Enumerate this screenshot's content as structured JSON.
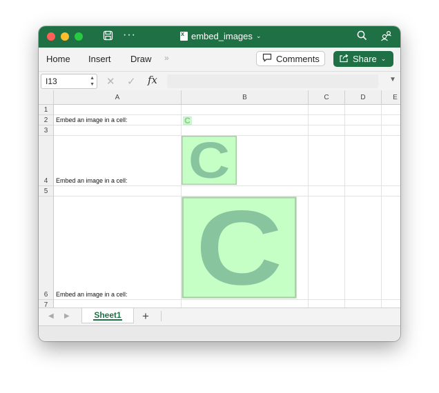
{
  "window": {
    "title": "embed_images"
  },
  "ribbon": {
    "tabs": [
      "Home",
      "Insert",
      "Draw"
    ],
    "more": "»",
    "comments_label": "Comments",
    "share_label": "Share"
  },
  "formula_bar": {
    "name_box": "I13",
    "fx_label": "fx",
    "value": ""
  },
  "columns": [
    "A",
    "B",
    "C",
    "D",
    "E"
  ],
  "rows": [
    {
      "num": "1",
      "text": ""
    },
    {
      "num": "2",
      "text": "Embed an image in a cell:"
    },
    {
      "num": "3",
      "text": ""
    },
    {
      "num": "4",
      "text": "Embed an image in a cell:"
    },
    {
      "num": "5",
      "text": ""
    },
    {
      "num": "6",
      "text": "Embed an image in a cell:"
    },
    {
      "num": "7",
      "text": ""
    }
  ],
  "embedded_images": [
    {
      "row": "2",
      "letter": "C"
    },
    {
      "row": "4",
      "letter": "C"
    },
    {
      "row": "6",
      "letter": "C"
    }
  ],
  "sheets": [
    {
      "name": "Sheet1",
      "active": true
    }
  ],
  "colors": {
    "accent": "#1f7145",
    "image_bg": "#c6ffc6",
    "image_letter": "#88c49e"
  }
}
